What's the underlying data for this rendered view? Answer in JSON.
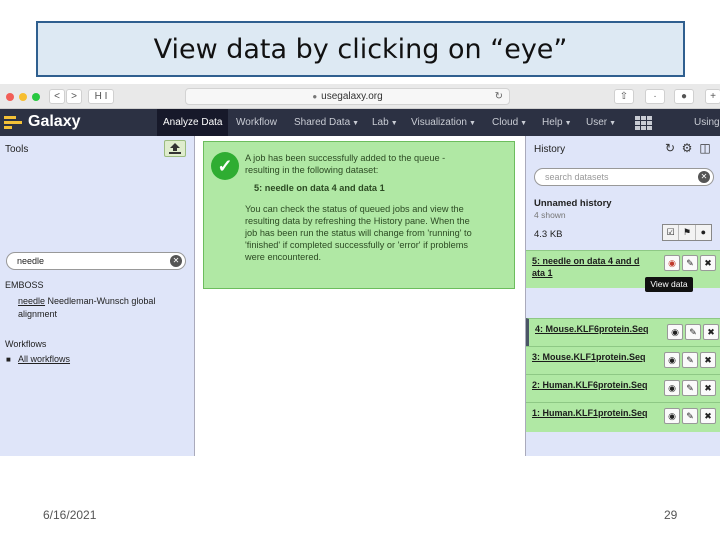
{
  "slide": {
    "title": "View data by clicking on “eye”",
    "date": "6/16/2021",
    "page_number": "29"
  },
  "browser": {
    "url": "usegalaxy.org",
    "tab_label": "H I",
    "nav_back": "<",
    "nav_forward": ">"
  },
  "masthead": {
    "logo": "Galaxy",
    "items": [
      {
        "label": "Analyze Data",
        "caret": false,
        "active": true
      },
      {
        "label": "Workflow",
        "caret": false,
        "active": false
      },
      {
        "label": "Shared Data",
        "caret": true,
        "active": false
      },
      {
        "label": "Lab",
        "caret": true,
        "active": false
      },
      {
        "label": "Visualization",
        "caret": true,
        "active": false
      },
      {
        "label": "Cloud",
        "caret": true,
        "active": false
      },
      {
        "label": "Help",
        "caret": true,
        "active": false
      },
      {
        "label": "User",
        "caret": true,
        "active": false
      }
    ],
    "usage_label": "Using"
  },
  "tools": {
    "header": "Tools",
    "search_value": "needle",
    "section_emboss": "EMBOSS",
    "tool_link": "needle",
    "tool_desc_1": "Needleman-Wunsch global",
    "tool_desc_2": "alignment",
    "section_workflows": "Workflows",
    "all_workflows": "All workflows"
  },
  "message": {
    "line1": "A job has been successfully added to the queue -",
    "line2": "resulting in the following dataset:",
    "dataset": "5: needle on data 4 and data 1",
    "p1": "You can check the status of queued jobs and view the",
    "p2": "resulting data by refreshing the History pane. When the",
    "p3": "job has been run the status will change from 'running' to",
    "p4": "'finished' if completed successfully or 'error' if problems",
    "p5": "were encountered."
  },
  "history": {
    "header": "History",
    "search_placeholder": "search datasets",
    "name": "Unnamed history",
    "shown": "4 shown",
    "size": "4.3 KB",
    "datasets": [
      {
        "name": "5: needle on data 4 and d ata 1"
      },
      {
        "name": "4: Mouse.KLF6protein.Seq"
      },
      {
        "name": "3: Mouse.KLF1protein.Seq"
      },
      {
        "name": "2: Human.KLF6protein.Seq"
      },
      {
        "name": "1: Human.KLF1protein.Seq"
      }
    ],
    "tooltip": "View data"
  },
  "colors": {
    "masthead": "#2c3143",
    "panel": "#dfe5f9",
    "ok_green": "#b0e8a4",
    "check_green": "#2fad32",
    "title_box_fill": "#dde9f3",
    "title_box_border": "#2f5f8f"
  }
}
